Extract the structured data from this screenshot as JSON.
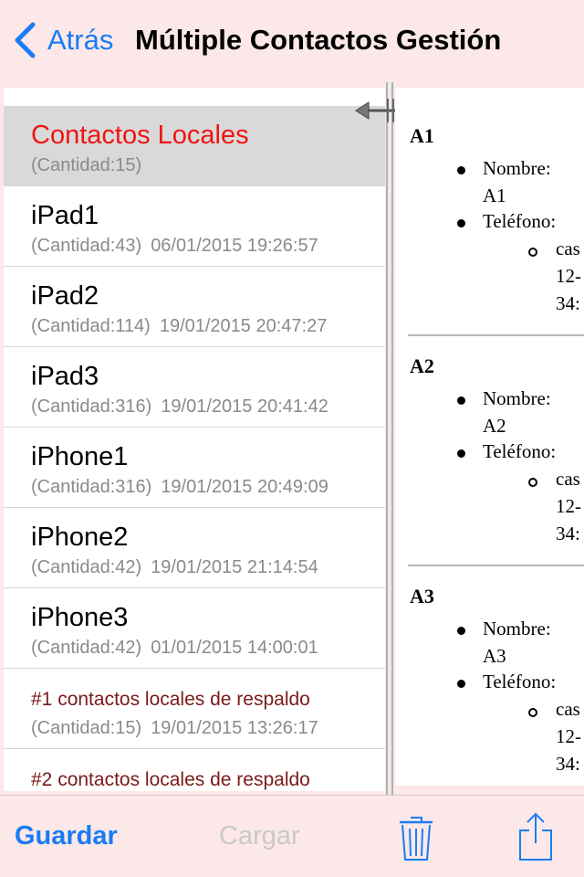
{
  "nav": {
    "back_label": "Atrás",
    "title": "Múltiple Contactos Gestión"
  },
  "list": {
    "items": [
      {
        "name": "Contactos Locales",
        "count": "(Cantidad:15)",
        "date": "",
        "selected": true
      },
      {
        "name": "iPad1",
        "count": "(Cantidad:43)",
        "date": "06/01/2015 19:26:57"
      },
      {
        "name": "iPad2",
        "count": "(Cantidad:114)",
        "date": "19/01/2015 20:47:27"
      },
      {
        "name": "iPad3",
        "count": "(Cantidad:316)",
        "date": "19/01/2015 20:41:42"
      },
      {
        "name": "iPhone1",
        "count": "(Cantidad:316)",
        "date": "19/01/2015 20:49:09"
      },
      {
        "name": "iPhone2",
        "count": "(Cantidad:42)",
        "date": "19/01/2015 21:14:54"
      },
      {
        "name": "iPhone3",
        "count": "(Cantidad:42)",
        "date": "01/01/2015 14:00:01"
      },
      {
        "name": "#1 contactos locales de respaldo",
        "count": "(Cantidad:15)",
        "date": "19/01/2015 13:26:17"
      },
      {
        "name": "#2 contactos locales de respaldo",
        "count": "",
        "date": ""
      }
    ]
  },
  "detail": {
    "contacts": [
      {
        "heading": "A1",
        "name_label": "Nombre:",
        "name_value": "A1",
        "phone_label": "Teléfono:",
        "phone_type": "cas",
        "phone_line1": "12-",
        "phone_line2": "34:"
      },
      {
        "heading": "A2",
        "name_label": "Nombre:",
        "name_value": "A2",
        "phone_label": "Teléfono:",
        "phone_type": "cas",
        "phone_line1": "12-",
        "phone_line2": "34:"
      },
      {
        "heading": "A3",
        "name_label": "Nombre:",
        "name_value": "A3",
        "phone_label": "Teléfono:",
        "phone_type": "cas",
        "phone_line1": "12-",
        "phone_line2": "34:"
      }
    ]
  },
  "toolbar": {
    "save_label": "Guardar",
    "load_label": "Cargar",
    "trash_icon": "trash-icon",
    "share_icon": "share-icon"
  },
  "colors": {
    "accent": "#1a7cf5",
    "selected_title": "#f01414",
    "backup_title": "#7a1a1a",
    "background": "#fce8e8"
  }
}
